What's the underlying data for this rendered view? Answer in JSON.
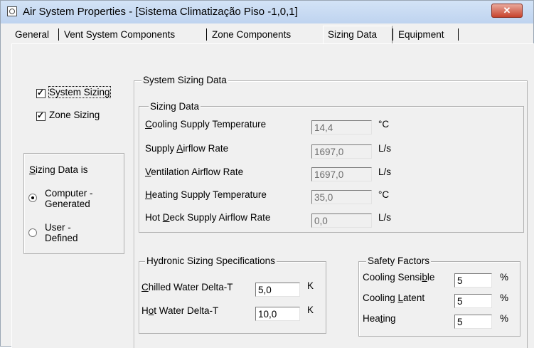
{
  "window": {
    "title": "Air System Properties - [Sistema Climatização Piso -1,0,1]",
    "close_glyph": "✕"
  },
  "tabs": [
    {
      "label": "General",
      "active": false
    },
    {
      "label": "Vent System Components",
      "active": false
    },
    {
      "label": "Zone Components",
      "active": false
    },
    {
      "label": "Sizing Data",
      "active": true
    },
    {
      "label": "Equipment",
      "active": false
    }
  ],
  "left": {
    "system_sizing": {
      "label": "System Sizing",
      "checked": true
    },
    "zone_sizing": {
      "label": "Zone Sizing",
      "checked": true
    },
    "sizing_data_is": {
      "title_pre": "",
      "title_accel": "S",
      "title_post": "izing Data is",
      "options": [
        {
          "line1": "Computer -",
          "line2": "Generated",
          "selected": true
        },
        {
          "line1": "User -",
          "line2": "Defined",
          "selected": false
        }
      ]
    }
  },
  "system_sizing_data": {
    "title": "System Sizing Data",
    "sizing_data": {
      "title": "Sizing Data",
      "rows": [
        {
          "pre": "",
          "accel": "C",
          "post": "ooling Supply Temperature",
          "value": "14,4",
          "unit": "°C"
        },
        {
          "pre": "Supply ",
          "accel": "A",
          "post": "irflow Rate",
          "value": "1697,0",
          "unit": "L/s"
        },
        {
          "pre": "",
          "accel": "V",
          "post": "entilation Airflow Rate",
          "value": "1697,0",
          "unit": "L/s"
        },
        {
          "pre": "",
          "accel": "H",
          "post": "eating Supply Temperature",
          "value": "35,0",
          "unit": "°C"
        },
        {
          "pre": "Hot ",
          "accel": "D",
          "post": "eck Supply Airflow Rate",
          "value": "0,0",
          "unit": "L/s"
        }
      ]
    },
    "hydronic": {
      "title": "Hydronic Sizing Specifications",
      "rows": [
        {
          "pre": "",
          "accel": "C",
          "post": "hilled Water Delta-T",
          "value": "5,0",
          "unit": "K"
        },
        {
          "pre": "H",
          "accel": "o",
          "post": "t Water Delta-T",
          "value": "10,0",
          "unit": "K"
        }
      ]
    },
    "safety": {
      "title": "Safety Factors",
      "rows": [
        {
          "pre": "Cooling Sensi",
          "accel": "b",
          "post": "le",
          "value": "5",
          "unit": "%"
        },
        {
          "pre": "Cooling ",
          "accel": "L",
          "post": "atent",
          "value": "5",
          "unit": "%"
        },
        {
          "pre": "Hea",
          "accel": "t",
          "post": "ing",
          "value": "5",
          "unit": "%"
        }
      ]
    }
  }
}
